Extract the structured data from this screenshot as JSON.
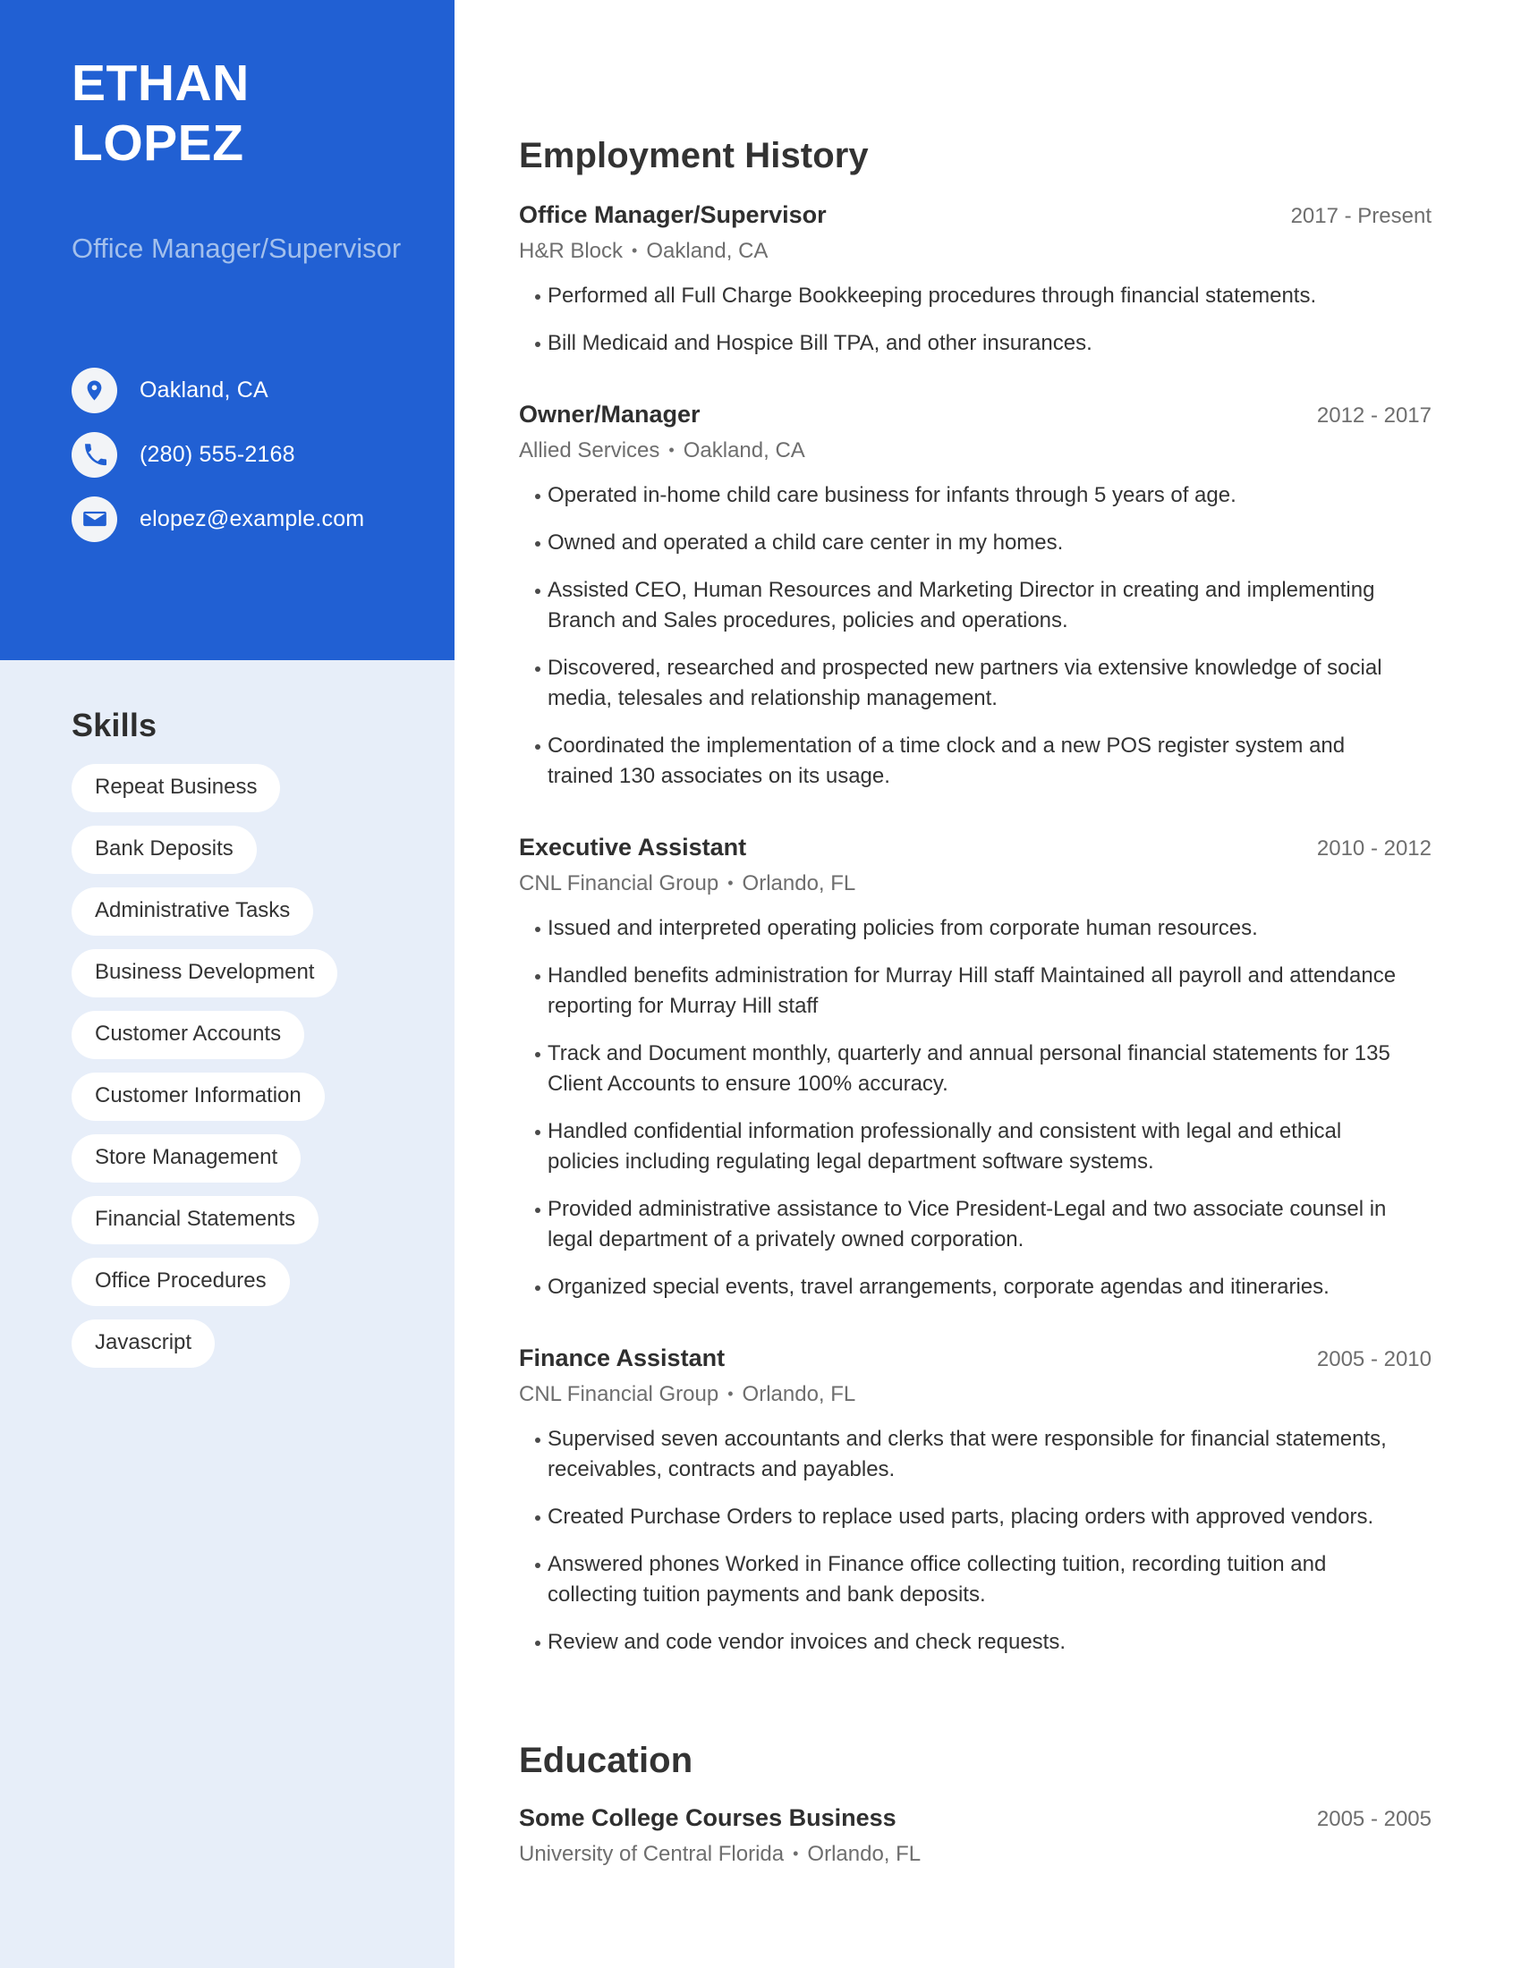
{
  "theme": {
    "accent": "#2160d3",
    "sidebar_bg": "#e7eef9",
    "pill_bg": "#ffffff",
    "subtitle_color": "#a3c0ec",
    "body_text": "#333333",
    "muted_text": "#6e6e6e"
  },
  "profile": {
    "first_name": "ETHAN",
    "last_name": "LOPEZ",
    "job_title": "Office Manager/Supervisor",
    "contacts": [
      {
        "icon": "location-pin-icon",
        "value": "Oakland, CA"
      },
      {
        "icon": "phone-icon",
        "value": "(280) 555-2168"
      },
      {
        "icon": "email-envelope-icon",
        "value": "elopez@example.com"
      }
    ]
  },
  "skills": {
    "title": "Skills",
    "items": [
      "Repeat Business",
      "Bank Deposits",
      "Administrative Tasks",
      "Business Development",
      "Customer Accounts",
      "Customer Information",
      "Store Management",
      "Financial Statements",
      "Office Procedures",
      "Javascript"
    ]
  },
  "employment": {
    "title": "Employment History",
    "entries": [
      {
        "role": "Office Manager/Supervisor",
        "dates": "2017 - Present",
        "company": "H&R Block",
        "location": "Oakland, CA",
        "bullets": [
          "Performed all Full Charge Bookkeeping procedures through financial statements.",
          "Bill Medicaid and Hospice Bill TPA, and other insurances."
        ]
      },
      {
        "role": "Owner/Manager",
        "dates": "2012 - 2017",
        "company": "Allied Services",
        "location": "Oakland, CA",
        "bullets": [
          "Operated in-home child care business for infants through 5 years of age.",
          "Owned and operated a child care center in my homes.",
          "Assisted CEO, Human Resources and Marketing Director in creating and implementing Branch and Sales procedures, policies and operations.",
          "Discovered, researched and prospected new partners via extensive knowledge of social media, telesales and relationship management.",
          "Coordinated the implementation of a time clock and a new POS register system and trained 130 associates on its usage."
        ]
      },
      {
        "role": "Executive Assistant",
        "dates": "2010 - 2012",
        "company": "CNL Financial Group",
        "location": "Orlando, FL",
        "bullets": [
          "Issued and interpreted operating policies from corporate human resources.",
          "Handled benefits administration for Murray Hill staff Maintained all payroll and attendance reporting for Murray Hill staff",
          "Track and Document monthly, quarterly and annual personal financial statements for 135 Client Accounts to ensure 100% accuracy.",
          "Handled confidential information professionally and consistent with legal and ethical policies including regulating legal department software systems.",
          "Provided administrative assistance to Vice President-Legal and two associate counsel in legal department of a privately owned corporation.",
          "Organized special events, travel arrangements, corporate agendas and itineraries."
        ]
      },
      {
        "role": "Finance Assistant",
        "dates": "2005 - 2010",
        "company": "CNL Financial Group",
        "location": "Orlando, FL",
        "bullets": [
          "Supervised seven accountants and clerks that were responsible for financial statements, receivables, contracts and payables.",
          "Created Purchase Orders to replace used parts, placing orders with approved vendors.",
          "Answered phones Worked in Finance office collecting tuition, recording tuition and collecting tuition payments and bank deposits.",
          "Review and code vendor invoices and check requests."
        ]
      }
    ]
  },
  "education": {
    "title": "Education",
    "entries": [
      {
        "degree": "Some College Courses Business",
        "dates": "2005 - 2005",
        "school": "University of Central Florida",
        "location": "Orlando, FL"
      }
    ]
  },
  "separator": "•"
}
